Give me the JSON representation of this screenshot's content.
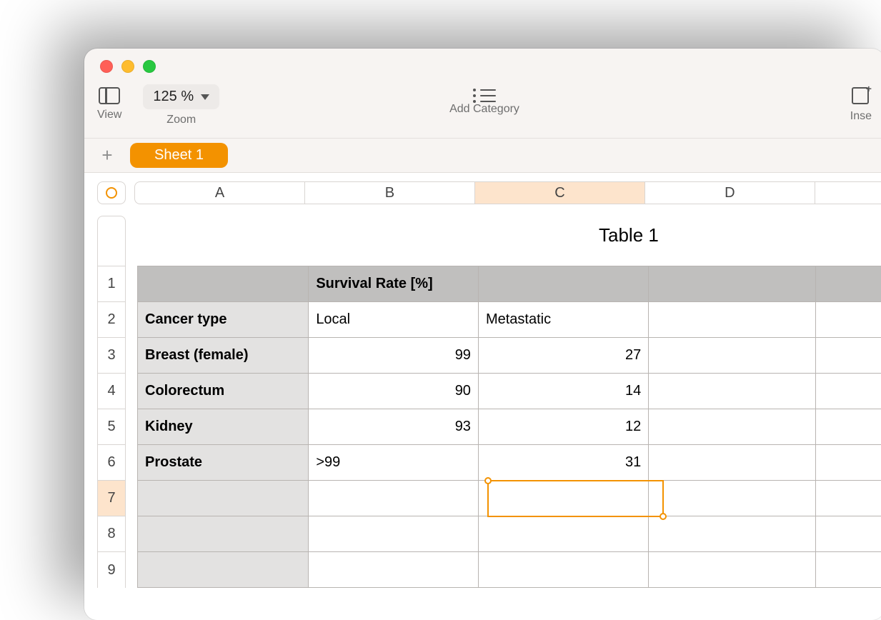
{
  "toolbar": {
    "view_label": "View",
    "zoom_label": "Zoom",
    "zoom_value": "125 %",
    "add_category_label": "Add Category",
    "insert_label": "Inse"
  },
  "tabs": {
    "sheet_name": "Sheet 1"
  },
  "columns": {
    "A": "A",
    "B": "B",
    "C": "C",
    "D": "D"
  },
  "rows": {
    "r1": "1",
    "r2": "2",
    "r3": "3",
    "r4": "4",
    "r5": "5",
    "r6": "6",
    "r7": "7",
    "r8": "8",
    "r9": "9"
  },
  "table": {
    "title": "Table 1",
    "header_b1": "Survival Rate [%]",
    "a2": "Cancer type",
    "b2": "Local",
    "c2": "Metastatic",
    "a3": "Breast (female)",
    "b3": "99",
    "c3": "27",
    "a4": "Colorectum",
    "b4": "90",
    "c4": "14",
    "a5": "Kidney",
    "b5": "93",
    "c5": "12",
    "a6": "Prostate",
    "b6": ">99",
    "c6": "31"
  },
  "selection": {
    "cell": "C7"
  },
  "chart_data": {
    "type": "table",
    "title": "Survival Rate [%]",
    "columns": [
      "Cancer type",
      "Local",
      "Metastatic"
    ],
    "rows": [
      {
        "cancer_type": "Breast (female)",
        "local": 99,
        "metastatic": 27,
        "local_raw": "99"
      },
      {
        "cancer_type": "Colorectum",
        "local": 90,
        "metastatic": 14,
        "local_raw": "90"
      },
      {
        "cancer_type": "Kidney",
        "local": 93,
        "metastatic": 12,
        "local_raw": "93"
      },
      {
        "cancer_type": "Prostate",
        "local": 99,
        "metastatic": 31,
        "local_raw": ">99"
      }
    ]
  }
}
